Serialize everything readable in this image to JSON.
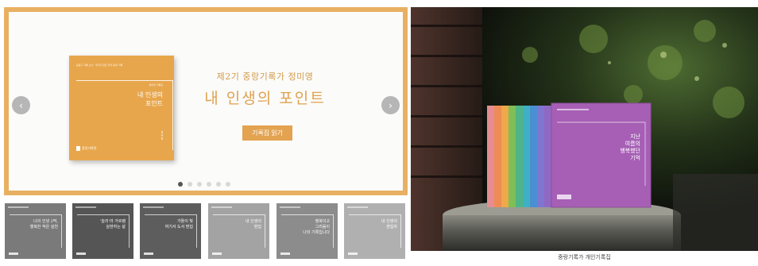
{
  "carousel": {
    "cover": {
      "top_line": "중랑구 기록 소사 · 우리가 만든 우리 동네 기록",
      "author_line": "정미영 기록집",
      "title": "내 인생의\n포인트",
      "vertical": "정 미 영",
      "publisher": "중랑기록관"
    },
    "subtitle": "제2기 중랑기록가 정미영",
    "title": "내 인생의 포인트",
    "read_button": "기록집 읽기",
    "prev_icon": "‹",
    "next_icon": "›",
    "dots": [
      true,
      false,
      false,
      false,
      false,
      false
    ]
  },
  "thumbnails": [
    {
      "title": "나의 인생 2막,\n행복한 작은 실천",
      "bg": "#7a7a7a"
    },
    {
      "title": "'늘리'라 가르렘\n실현하는 삶",
      "bg": "#555555"
    },
    {
      "title": "가톨이 빛\n여기서 도서 편집",
      "bg": "#5d5d5d"
    },
    {
      "title": "내 인생의\n편집",
      "bg": "#a3a3a3"
    },
    {
      "title": "행복이고\n그리움이\n나의 기록입니다",
      "bg": "#8c8c8c"
    },
    {
      "title": "내 인생의\n편집자",
      "bg": "#b0b0b0"
    }
  ],
  "photo": {
    "front_book_title": "지난\n여름의\n행복했던\n기억",
    "front_book_color": "#a65fb5",
    "caption": "중랑기록가 개인기록집"
  }
}
